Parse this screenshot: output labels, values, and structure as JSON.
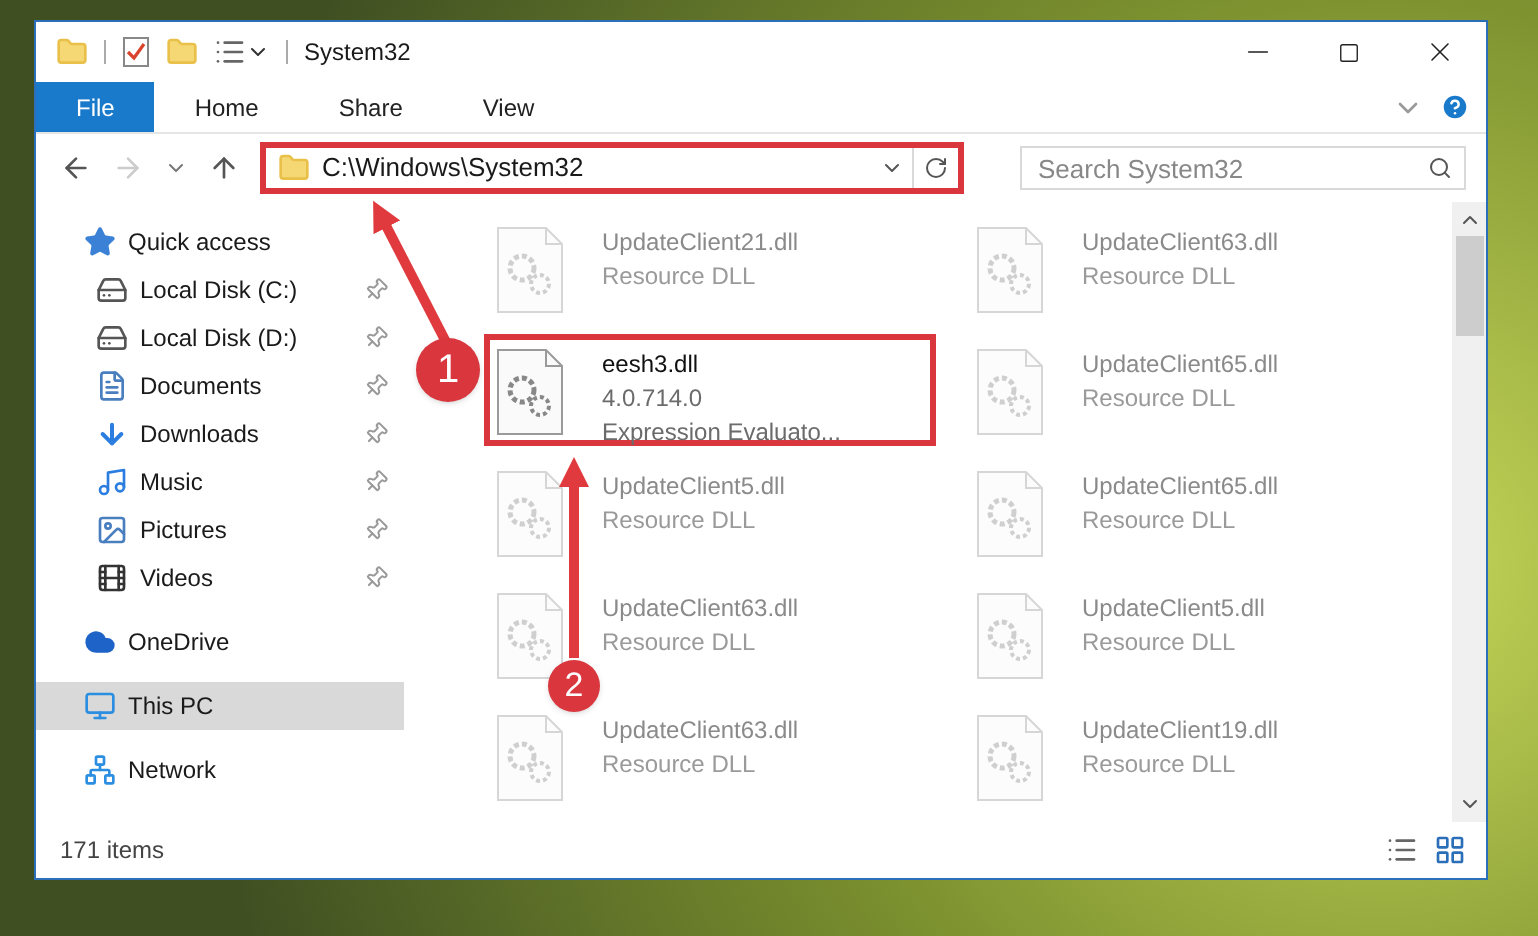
{
  "window": {
    "title": "System32"
  },
  "ribbon_tabs": [
    {
      "label": "File",
      "selected": true
    },
    {
      "label": "Home",
      "selected": false
    },
    {
      "label": "Share",
      "selected": false
    },
    {
      "label": "View",
      "selected": false
    }
  ],
  "address_bar": {
    "path": "C:\\Windows\\System32",
    "highlighted": true
  },
  "search": {
    "placeholder": "Search System32"
  },
  "sidebar": {
    "items": [
      {
        "label": "Quick access",
        "selected": false,
        "children": [
          {
            "label": "Local Disk (C:)",
            "pinned": true,
            "selected": false
          },
          {
            "label": "Local Disk (D:)",
            "pinned": true,
            "selected": false
          },
          {
            "label": "Documents",
            "pinned": true,
            "selected": false
          },
          {
            "label": "Downloads",
            "pinned": true,
            "selected": false
          },
          {
            "label": "Music",
            "pinned": true,
            "selected": false
          },
          {
            "label": "Pictures",
            "pinned": true,
            "selected": false
          },
          {
            "label": "Videos",
            "pinned": true,
            "selected": false
          }
        ]
      },
      {
        "label": "OneDrive",
        "selected": false
      },
      {
        "label": "This PC",
        "selected": true
      },
      {
        "label": "Network",
        "selected": false
      }
    ]
  },
  "files": [
    {
      "name": "UpdateClient21.dll",
      "details": [
        "Resource DLL"
      ],
      "dimmed": true,
      "highlighted": false
    },
    {
      "name": "UpdateClient63.dll",
      "details": [
        "Resource DLL"
      ],
      "dimmed": true,
      "highlighted": false
    },
    {
      "name": "eesh3.dll",
      "details": [
        "4.0.714.0",
        "Expression Evaluato..."
      ],
      "dimmed": false,
      "highlighted": true
    },
    {
      "name": "UpdateClient65.dll",
      "details": [
        "Resource DLL"
      ],
      "dimmed": true,
      "highlighted": false
    },
    {
      "name": "UpdateClient5.dll",
      "details": [
        "Resource DLL"
      ],
      "dimmed": true,
      "highlighted": false
    },
    {
      "name": "UpdateClient65.dll",
      "details": [
        "Resource DLL"
      ],
      "dimmed": true,
      "highlighted": false
    },
    {
      "name": "UpdateClient63.dll",
      "details": [
        "Resource DLL"
      ],
      "dimmed": true,
      "highlighted": false
    },
    {
      "name": "UpdateClient5.dll",
      "details": [
        "Resource DLL"
      ],
      "dimmed": true,
      "highlighted": false
    },
    {
      "name": "UpdateClient63.dll",
      "details": [
        "Resource DLL"
      ],
      "dimmed": true,
      "highlighted": false
    },
    {
      "name": "UpdateClient19.dll",
      "details": [
        "Resource DLL"
      ],
      "dimmed": true,
      "highlighted": false
    }
  ],
  "status_bar": {
    "item_count": "171 items"
  },
  "callouts": [
    {
      "number": "1"
    },
    {
      "number": "2"
    }
  ]
}
